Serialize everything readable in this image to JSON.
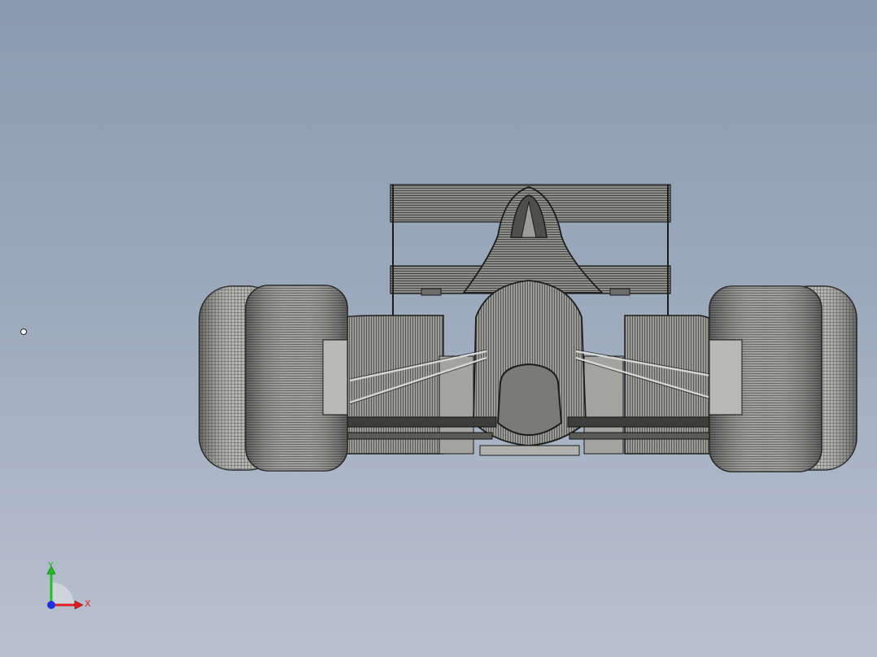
{
  "viewport": {
    "background_top": "#8a9ab0",
    "background_bottom": "#b9c1cf",
    "model_fill": "#8e8f8a",
    "model_line": "#1c1c1c"
  },
  "triad": {
    "x_label": "X",
    "y_label": "Y",
    "x_color": "#e02020",
    "y_color": "#20c020",
    "z_color": "#2030e0"
  }
}
